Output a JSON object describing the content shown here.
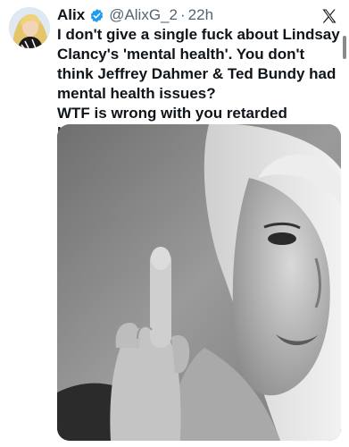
{
  "tweet": {
    "author": {
      "display_name": "Alix",
      "handle": "@AlixG_2",
      "verified": true,
      "avatar_icon": "avatar-photo"
    },
    "separator": "·",
    "timestamp": "22h",
    "text_lines": [
      "I don't give a single fuck about Lindsay Clancy's 'mental health'. You don't think Jeffrey Dahmer & Ted Bundy had mental health issues?",
      "WTF is wrong with you retarded bitches?"
    ],
    "media": {
      "kind": "photo",
      "style": "black-and-white"
    }
  },
  "icons": {
    "verified": "verified-badge-icon",
    "platform": "x-logo-icon"
  },
  "colors": {
    "verified_blue": "#1d9bf0",
    "text_primary": "#0f1419",
    "text_secondary": "#536471"
  }
}
